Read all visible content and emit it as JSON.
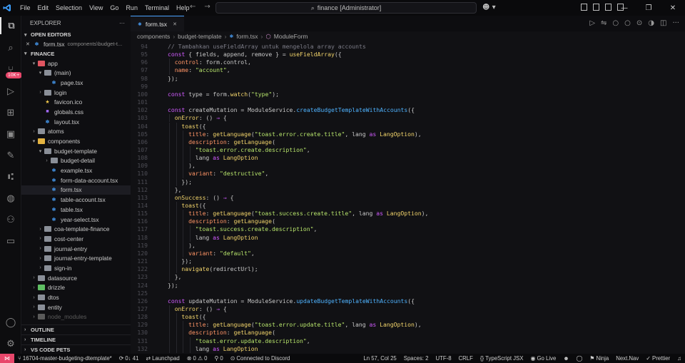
{
  "titlebar": {
    "menu": [
      "File",
      "Edit",
      "Selection",
      "View",
      "Go",
      "Run",
      "Terminal",
      "Help"
    ],
    "search": "finance [Administrator]"
  },
  "activity": {
    "badge": "10K+"
  },
  "sidebar": {
    "title": "EXPLORER",
    "open_editors_label": "OPEN EDITORS",
    "open_editor_file": "form.tsx",
    "open_editor_path": "components\\budget-t...",
    "root_label": "FINANCE",
    "tree": [
      {
        "label": "app",
        "depth": 1,
        "kind": "folder-red",
        "open": true
      },
      {
        "label": "(main)",
        "depth": 2,
        "kind": "folder",
        "open": true
      },
      {
        "label": "page.tsx",
        "depth": 3,
        "kind": "tsx"
      },
      {
        "label": "login",
        "depth": 2,
        "kind": "folder",
        "open": false
      },
      {
        "label": "favicon.ico",
        "depth": 2,
        "kind": "star"
      },
      {
        "label": "globals.css",
        "depth": 2,
        "kind": "css"
      },
      {
        "label": "layout.tsx",
        "depth": 2,
        "kind": "tsx"
      },
      {
        "label": "atoms",
        "depth": 1,
        "kind": "folder",
        "open": false
      },
      {
        "label": "components",
        "depth": 1,
        "kind": "folder-yellow",
        "open": true
      },
      {
        "label": "budget-template",
        "depth": 2,
        "kind": "folder",
        "open": true
      },
      {
        "label": "budget-detail",
        "depth": 3,
        "kind": "folder",
        "open": false
      },
      {
        "label": "example.tsx",
        "depth": 3,
        "kind": "tsx"
      },
      {
        "label": "form-data-account.tsx",
        "depth": 3,
        "kind": "tsx"
      },
      {
        "label": "form.tsx",
        "depth": 3,
        "kind": "tsx",
        "active": true
      },
      {
        "label": "table-account.tsx",
        "depth": 3,
        "kind": "tsx"
      },
      {
        "label": "table.tsx",
        "depth": 3,
        "kind": "tsx"
      },
      {
        "label": "year-select.tsx",
        "depth": 3,
        "kind": "tsx"
      },
      {
        "label": "coa-template-finance",
        "depth": 2,
        "kind": "folder",
        "open": false
      },
      {
        "label": "cost-center",
        "depth": 2,
        "kind": "folder",
        "open": false
      },
      {
        "label": "journal-entry",
        "depth": 2,
        "kind": "folder",
        "open": false
      },
      {
        "label": "journal-entry-template",
        "depth": 2,
        "kind": "folder",
        "open": false
      },
      {
        "label": "sign-in",
        "depth": 2,
        "kind": "folder",
        "open": false
      },
      {
        "label": "datasource",
        "depth": 1,
        "kind": "folder",
        "open": false
      },
      {
        "label": "drizzle",
        "depth": 1,
        "kind": "folder-green",
        "open": false
      },
      {
        "label": "dtos",
        "depth": 1,
        "kind": "folder",
        "open": false
      },
      {
        "label": "entity",
        "depth": 1,
        "kind": "folder",
        "open": false
      },
      {
        "label": "node_modules",
        "depth": 1,
        "kind": "folder-dim",
        "open": false
      }
    ],
    "bottom_sections": [
      "OUTLINE",
      "TIMELINE",
      "VS CODE PETS"
    ]
  },
  "editor": {
    "tab_label": "form.tsx",
    "breadcrumb": [
      "components",
      "budget-template",
      "form.tsx",
      "ModuleForm"
    ],
    "lines": [
      {
        "n": "94",
        "i": 0,
        "t": [
          [
            "cmt",
            "// Tambahkan useFieldArray untuk mengelola array accounts"
          ]
        ]
      },
      {
        "n": "95",
        "i": 0,
        "t": [
          [
            "kw",
            "const"
          ],
          [
            "pn",
            " { fields, append, remove } = "
          ],
          [
            "fn",
            "useFieldArray"
          ],
          [
            "pn",
            "({"
          ]
        ]
      },
      {
        "n": "96",
        "i": 1,
        "t": [
          [
            "prop",
            "control"
          ],
          [
            "pn",
            ": form.control,"
          ]
        ]
      },
      {
        "n": "97",
        "i": 1,
        "t": [
          [
            "prop",
            "name"
          ],
          [
            "pn",
            ": "
          ],
          [
            "str",
            "\"account\""
          ],
          [
            "pn",
            ","
          ]
        ]
      },
      {
        "n": "98",
        "i": 0,
        "t": [
          [
            "pn",
            "});"
          ]
        ]
      },
      {
        "n": "99",
        "i": 0,
        "t": []
      },
      {
        "n": "100",
        "i": 0,
        "t": [
          [
            "kw",
            "const"
          ],
          [
            "pn",
            " type = form."
          ],
          [
            "fn",
            "watch"
          ],
          [
            "pn",
            "("
          ],
          [
            "str",
            "\"type\""
          ],
          [
            "pn",
            ");"
          ]
        ]
      },
      {
        "n": "101",
        "i": 0,
        "t": []
      },
      {
        "n": "102",
        "i": 0,
        "t": [
          [
            "kw",
            "const"
          ],
          [
            "pn",
            " createMutation = ModuleService."
          ],
          [
            "mth",
            "createBudgetTemplateWithAccounts"
          ],
          [
            "pn",
            "({"
          ]
        ]
      },
      {
        "n": "103",
        "i": 1,
        "t": [
          [
            "fn",
            "onError"
          ],
          [
            "pn",
            ": () "
          ],
          [
            "kw",
            "⇒"
          ],
          [
            "pn",
            " {"
          ]
        ]
      },
      {
        "n": "104",
        "i": 2,
        "t": [
          [
            "fn",
            "toast"
          ],
          [
            "pn",
            "({"
          ]
        ]
      },
      {
        "n": "105",
        "i": 3,
        "t": [
          [
            "prop",
            "title"
          ],
          [
            "pn",
            ": "
          ],
          [
            "fn",
            "getLanguage"
          ],
          [
            "pn",
            "("
          ],
          [
            "str",
            "\"toast.error.create.title\""
          ],
          [
            "pn",
            ", lang "
          ],
          [
            "kw",
            "as"
          ],
          [
            "pn",
            " "
          ],
          [
            "typ",
            "LangOption"
          ],
          [
            "pn",
            "),"
          ]
        ]
      },
      {
        "n": "106",
        "i": 3,
        "t": [
          [
            "prop",
            "description"
          ],
          [
            "pn",
            ": "
          ],
          [
            "fn",
            "getLanguage"
          ],
          [
            "pn",
            "("
          ]
        ]
      },
      {
        "n": "107",
        "i": 4,
        "t": [
          [
            "str",
            "\"toast.error.create.description\""
          ],
          [
            "pn",
            ","
          ]
        ]
      },
      {
        "n": "108",
        "i": 4,
        "t": [
          [
            "pn",
            "lang "
          ],
          [
            "kw",
            "as"
          ],
          [
            "pn",
            " "
          ],
          [
            "typ",
            "LangOption"
          ]
        ]
      },
      {
        "n": "109",
        "i": 3,
        "t": [
          [
            "pn",
            "),"
          ]
        ]
      },
      {
        "n": "110",
        "i": 3,
        "t": [
          [
            "prop",
            "variant"
          ],
          [
            "pn",
            ": "
          ],
          [
            "str",
            "\"destructive\""
          ],
          [
            "pn",
            ","
          ]
        ]
      },
      {
        "n": "111",
        "i": 2,
        "t": [
          [
            "pn",
            "});"
          ]
        ]
      },
      {
        "n": "112",
        "i": 1,
        "t": [
          [
            "pn",
            "},"
          ]
        ]
      },
      {
        "n": "113",
        "i": 1,
        "t": [
          [
            "fn",
            "onSuccess"
          ],
          [
            "pn",
            ": () "
          ],
          [
            "kw",
            "⇒"
          ],
          [
            "pn",
            " {"
          ]
        ]
      },
      {
        "n": "114",
        "i": 2,
        "t": [
          [
            "fn",
            "toast"
          ],
          [
            "pn",
            "({"
          ]
        ]
      },
      {
        "n": "115",
        "i": 3,
        "t": [
          [
            "prop",
            "title"
          ],
          [
            "pn",
            ": "
          ],
          [
            "fn",
            "getLanguage"
          ],
          [
            "pn",
            "("
          ],
          [
            "str",
            "\"toast.success.create.title\""
          ],
          [
            "pn",
            ", lang "
          ],
          [
            "kw",
            "as"
          ],
          [
            "pn",
            " "
          ],
          [
            "typ",
            "LangOption"
          ],
          [
            "pn",
            "),"
          ]
        ]
      },
      {
        "n": "116",
        "i": 3,
        "t": [
          [
            "prop",
            "description"
          ],
          [
            "pn",
            ": "
          ],
          [
            "fn",
            "getLanguage"
          ],
          [
            "pn",
            "("
          ]
        ]
      },
      {
        "n": "117",
        "i": 4,
        "t": [
          [
            "str",
            "\"toast.success.create.description\""
          ],
          [
            "pn",
            ","
          ]
        ]
      },
      {
        "n": "118",
        "i": 4,
        "t": [
          [
            "pn",
            "lang "
          ],
          [
            "kw",
            "as"
          ],
          [
            "pn",
            " "
          ],
          [
            "typ",
            "LangOption"
          ]
        ]
      },
      {
        "n": "119",
        "i": 3,
        "t": [
          [
            "pn",
            "),"
          ]
        ]
      },
      {
        "n": "120",
        "i": 3,
        "t": [
          [
            "prop",
            "variant"
          ],
          [
            "pn",
            ": "
          ],
          [
            "str",
            "\"default\""
          ],
          [
            "pn",
            ","
          ]
        ]
      },
      {
        "n": "121",
        "i": 2,
        "t": [
          [
            "pn",
            "});"
          ]
        ]
      },
      {
        "n": "122",
        "i": 2,
        "t": [
          [
            "fn",
            "navigate"
          ],
          [
            "pn",
            "(redirectUrl);"
          ]
        ]
      },
      {
        "n": "123",
        "i": 1,
        "t": [
          [
            "pn",
            "},"
          ]
        ]
      },
      {
        "n": "124",
        "i": 0,
        "t": [
          [
            "pn",
            "});"
          ]
        ]
      },
      {
        "n": "125",
        "i": 0,
        "t": []
      },
      {
        "n": "126",
        "i": 0,
        "t": [
          [
            "kw",
            "const"
          ],
          [
            "pn",
            " updateMutation = ModuleService."
          ],
          [
            "mth",
            "updateBudgetTemplateWithAccounts"
          ],
          [
            "pn",
            "({"
          ]
        ]
      },
      {
        "n": "127",
        "i": 1,
        "t": [
          [
            "fn",
            "onError"
          ],
          [
            "pn",
            ": () "
          ],
          [
            "kw",
            "⇒"
          ],
          [
            "pn",
            " {"
          ]
        ]
      },
      {
        "n": "128",
        "i": 2,
        "t": [
          [
            "fn",
            "toast"
          ],
          [
            "pn",
            "({"
          ]
        ]
      },
      {
        "n": "129",
        "i": 3,
        "t": [
          [
            "prop",
            "title"
          ],
          [
            "pn",
            ": "
          ],
          [
            "fn",
            "getLanguage"
          ],
          [
            "pn",
            "("
          ],
          [
            "str",
            "\"toast.error.update.title\""
          ],
          [
            "pn",
            ", lang "
          ],
          [
            "kw",
            "as"
          ],
          [
            "pn",
            " "
          ],
          [
            "typ",
            "LangOption"
          ],
          [
            "pn",
            "),"
          ]
        ]
      },
      {
        "n": "130",
        "i": 3,
        "t": [
          [
            "prop",
            "description"
          ],
          [
            "pn",
            ": "
          ],
          [
            "fn",
            "getLanguage"
          ],
          [
            "pn",
            "("
          ]
        ]
      },
      {
        "n": "131",
        "i": 4,
        "t": [
          [
            "str",
            "\"toast.error.update.description\""
          ],
          [
            "pn",
            ","
          ]
        ]
      },
      {
        "n": "132",
        "i": 4,
        "t": [
          [
            "pn",
            "lang "
          ],
          [
            "kw",
            "as"
          ],
          [
            "pn",
            " "
          ],
          [
            "typ",
            "LangOption"
          ]
        ]
      }
    ]
  },
  "statusbar": {
    "branch": "16704-master-budgeting-dtemplate*",
    "sync": "0↓ 41",
    "launchpad": "Launchpad",
    "problems": "⊗ 0  ⚠ 0",
    "ports": "0",
    "discord": "Connected to Discord",
    "position": "Ln 57, Col 25",
    "spaces": "Spaces: 2",
    "encoding": "UTF-8",
    "eol": "CRLF",
    "language": "{} TypeScript JSX",
    "golive": "Go Live",
    "ninja": "Ninja",
    "nextnav": "Next.Nav",
    "prettier": "✓ Prettier"
  }
}
